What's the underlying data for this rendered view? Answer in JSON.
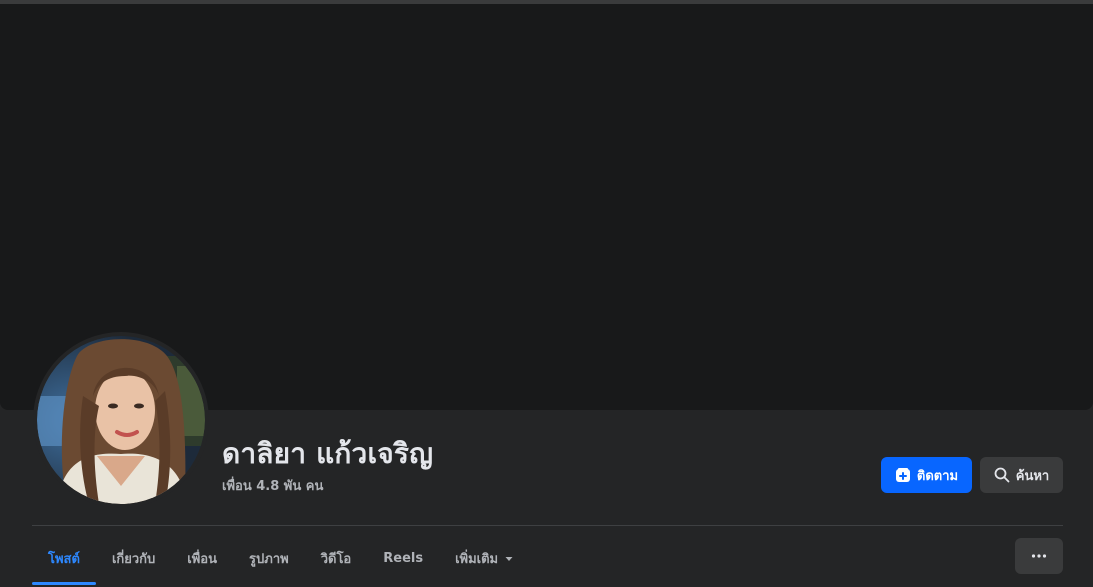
{
  "profile": {
    "name": "ดาลิยา แก้วเจริญ",
    "friends_text": "เพื่อน 4.8 พัน คน"
  },
  "actions": {
    "follow_label": "ติดตาม",
    "search_label": "ค้นหา"
  },
  "tabs": [
    {
      "label": "โพสต์",
      "active": true
    },
    {
      "label": "เกี่ยวกับ",
      "active": false
    },
    {
      "label": "เพื่อน",
      "active": false
    },
    {
      "label": "รูปภาพ",
      "active": false
    },
    {
      "label": "วิดีโอ",
      "active": false
    },
    {
      "label": "Reels",
      "active": false
    },
    {
      "label": "เพิ่มเติม",
      "active": false
    }
  ],
  "icons": {
    "follow": "follow-plus-icon",
    "search": "search-icon",
    "dropdown": "caret-down-icon",
    "more": "more-horizontal-icon"
  },
  "colors": {
    "accent": "#0866ff",
    "active_tab": "#2d88ff",
    "background": "#242526",
    "cover": "#18191a"
  }
}
